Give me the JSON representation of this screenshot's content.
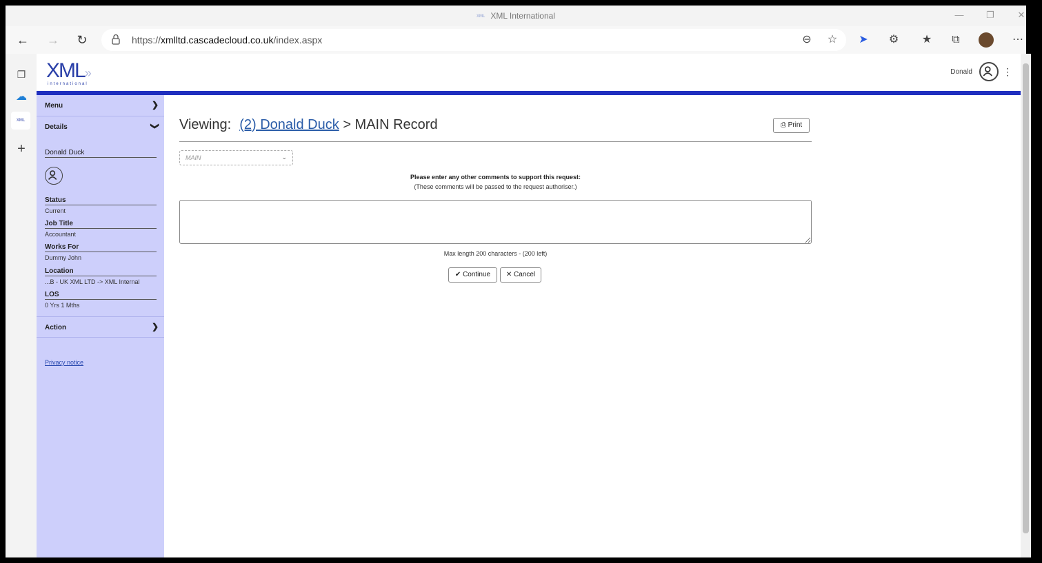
{
  "window": {
    "title": "XML International",
    "favicon_text": "XML"
  },
  "browser": {
    "url_prefix": "https://",
    "url_domain": "xmlltd.cascadecloud.co.uk",
    "url_path": "/index.aspx"
  },
  "header": {
    "logo_text": "XML",
    "logo_sub": "international",
    "user_name": "Donald"
  },
  "sidebar": {
    "menu_label": "Menu",
    "details_label": "Details",
    "person_name": "Donald Duck",
    "fields": [
      {
        "label": "Status",
        "value": "Current"
      },
      {
        "label": "Job Title",
        "value": "Accountant"
      },
      {
        "label": "Works For",
        "value": "Dummy John"
      },
      {
        "label": "Location",
        "value": "...B - UK XML LTD -> XML Internal"
      },
      {
        "label": "LOS",
        "value": "0 Yrs 1 Mths"
      }
    ],
    "action_label": "Action",
    "privacy_label": "Privacy notice"
  },
  "main": {
    "viewing_label": "Viewing:",
    "person_link": "(2) Donald Duck",
    "record_suffix": "> MAIN Record",
    "print_label": "Print",
    "record_select_value": "MAIN",
    "prompt_line1": "Please enter any other comments to support this request:",
    "prompt_line2": "(These comments will be passed to the request authoriser.)",
    "comments_value": "",
    "max_length_text": "Max length 200 characters - (200 left)",
    "continue_label": "Continue",
    "cancel_label": "Cancel"
  },
  "colors": {
    "brand_blue": "#1f2fbf",
    "sidebar_bg": "#cdcffb",
    "link_blue": "#2a5ca8"
  }
}
